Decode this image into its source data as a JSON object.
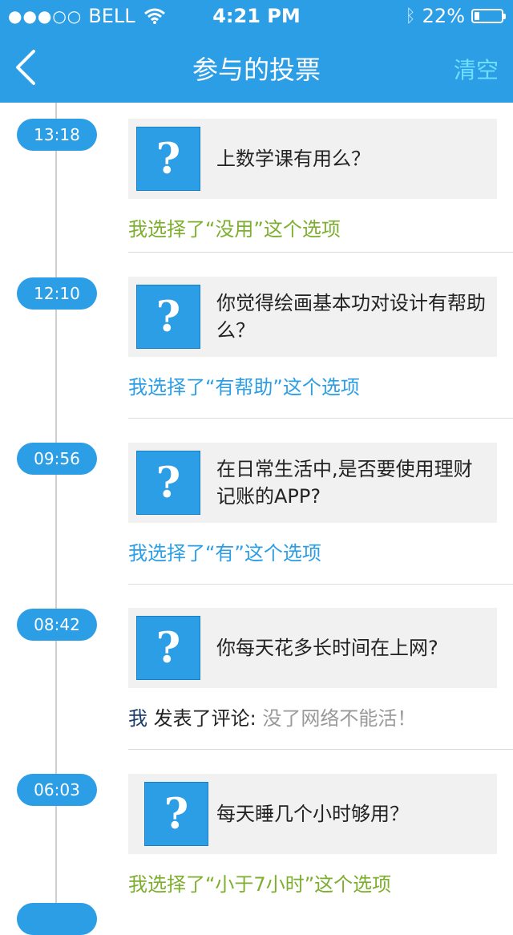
{
  "status": {
    "dots": "●●●○○",
    "carrier": "BELL",
    "time": "4:21 PM",
    "battery": "22%"
  },
  "nav": {
    "title": "参与的投票",
    "clear": "清空"
  },
  "items": [
    {
      "time": "13:18",
      "icon": "?",
      "question": "上数学课有用么？",
      "choice": "我选择了“没用”这个选项"
    },
    {
      "time": "12:10",
      "icon": "?",
      "question": "你觉得绘画基本功对设计有帮助么？",
      "choice": "我选择了“有帮助”这个选项"
    },
    {
      "time": "09:56",
      "icon": "?",
      "question": "在日常生活中,是否要使用理财记账的APP?",
      "choice": "我选择了“有”这个选项"
    },
    {
      "time": "08:42",
      "icon": "?",
      "question": "你每天花多长时间在上网?",
      "comment_user": "我",
      "comment_verb": "发表了评论:",
      "comment_text": "没了网络不能活！"
    },
    {
      "time": "06:03",
      "icon": "?",
      "question": "每天睡几个小时够用？",
      "choice": "我选择了“小于7小时”这个选项"
    }
  ]
}
